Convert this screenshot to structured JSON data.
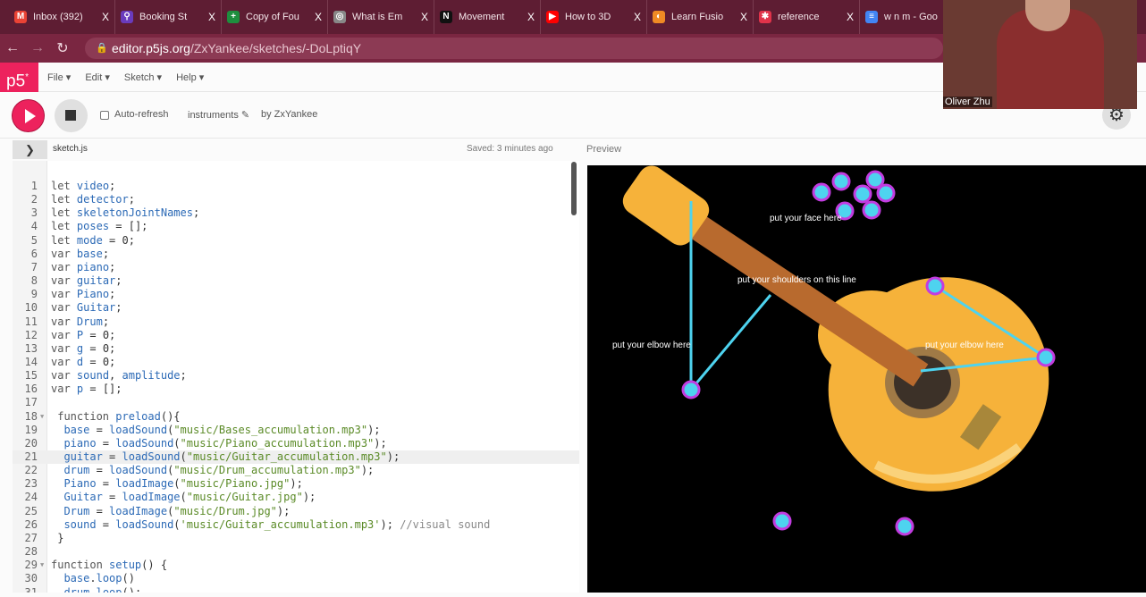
{
  "browser": {
    "tabs": [
      {
        "label": "Inbox (392)",
        "icon": "gmail-icon",
        "color": "#ea4335",
        "glyph": "M"
      },
      {
        "label": "Booking St",
        "icon": "booking-icon",
        "color": "#6a3bbd",
        "glyph": "⚲"
      },
      {
        "label": "Copy of Fou",
        "icon": "sheets-icon",
        "color": "#1e8e3e",
        "glyph": "+"
      },
      {
        "label": "What is Em",
        "icon": "globe-icon",
        "color": "#888",
        "glyph": "◎"
      },
      {
        "label": "Movement",
        "icon": "notion-icon",
        "color": "#111",
        "glyph": "N"
      },
      {
        "label": "How to 3D",
        "icon": "youtube-icon",
        "color": "#ff0000",
        "glyph": "▶"
      },
      {
        "label": "Learn Fusio",
        "icon": "fusion-icon",
        "color": "#f08a24",
        "glyph": "◐"
      },
      {
        "label": "reference",
        "icon": "star-icon",
        "color": "#e0334a",
        "glyph": "✱"
      },
      {
        "label": "w n m - Goo",
        "icon": "docs-icon",
        "color": "#4285f4",
        "glyph": "≡"
      }
    ],
    "close_glyph": "X",
    "url_host": "editor.p5js.org",
    "url_path": "/ZxYankee/sketches/-DoLptiqY"
  },
  "app": {
    "logo": "p5",
    "menus": [
      "File ▾",
      "Edit ▾",
      "Sketch ▾",
      "Help ▾"
    ],
    "auto_refresh": "Auto-refresh",
    "sketch_name": "instruments ✎",
    "author": "by ZxYankee",
    "file_name": "sketch.js",
    "saved": "Saved: 3 minutes ago",
    "preview": "Preview",
    "active_line": 21
  },
  "code": [
    "let video;",
    "let detector;",
    "let skeletonJointNames;",
    "let poses = [];",
    "let mode = 0;",
    "var base;",
    "var piano;",
    "var guitar;",
    "var Piano;",
    "var Guitar;",
    "var Drum;",
    "var P = 0;",
    "var g = 0;",
    "var d = 0;",
    "var sound, amplitude;",
    "var p = [];",
    "",
    " function preload(){",
    "  base = loadSound(\"music/Bases_accumulation.mp3\");",
    "  piano = loadSound(\"music/Piano_accumulation.mp3\");",
    "  guitar = loadSound(\"music/Guitar_accumulation.mp3\");",
    "  drum = loadSound(\"music/Drum_accumulation.mp3\");",
    "  Piano = loadImage(\"music/Piano.jpg\");",
    "  Guitar = loadImage(\"music/Guitar.jpg\");",
    "  Drum = loadImage(\"music/Drum.jpg\");",
    "  sound = loadSound('music/Guitar_accumulation.mp3'); //visual sound",
    " }",
    "",
    "function setup() {",
    "  base.loop()",
    "  drum.loop();"
  ],
  "preview_labels": {
    "face": "put your face here",
    "shoulders": "put  your  shoulders  on  this  line",
    "elbow_left": "put your elbow here",
    "elbow_right": "put your elbow here"
  },
  "webcam": {
    "name": "Oliver Zhu"
  }
}
